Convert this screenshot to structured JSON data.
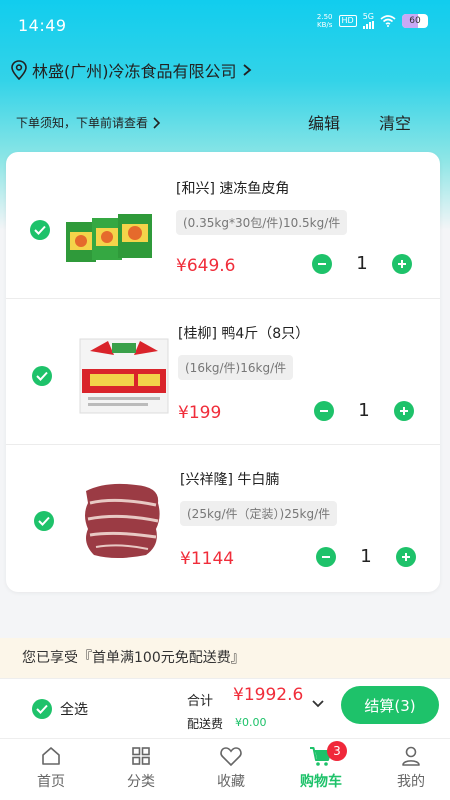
{
  "status_bar": {
    "time": "14:49",
    "net_speed_value": "2.50",
    "net_speed_unit": "KB/s",
    "hd": "HD",
    "network": "5G",
    "battery": "60"
  },
  "header": {
    "company": "林盛(广州)冷冻食品有限公司",
    "notice": "下单须知，下单前请查看",
    "edit_label": "编辑",
    "clear_label": "清空"
  },
  "cart": {
    "items": [
      {
        "name": "[和兴] 速冻鱼皮角",
        "spec": "(0.35kg*30包/件)10.5kg/件",
        "price": "¥649.6",
        "quantity": "1",
        "checked": true
      },
      {
        "name": "[桂柳] 鸭4斤（8只）",
        "spec": "(16kg/件)16kg/件",
        "price": "¥199",
        "quantity": "1",
        "checked": true
      },
      {
        "name": "[兴祥隆] 牛白腩",
        "spec": "(25kg/件（定装）)25kg/件",
        "price": "¥1144",
        "quantity": "1",
        "checked": true
      }
    ]
  },
  "promo": "您已享受『首单满100元免配送费』",
  "checkout": {
    "select_all_label": "全选",
    "total_label": "合计",
    "total_value": "¥1992.6",
    "fee_label": "配送费",
    "fee_value": "¥0.00",
    "button_label": "结算(3)"
  },
  "tabbar": {
    "tabs": [
      {
        "label": "首页",
        "icon": "home-icon"
      },
      {
        "label": "分类",
        "icon": "category-icon"
      },
      {
        "label": "收藏",
        "icon": "heart-icon"
      },
      {
        "label": "购物车",
        "icon": "cart-icon",
        "active": true,
        "badge": "3"
      },
      {
        "label": "我的",
        "icon": "user-icon"
      }
    ]
  },
  "colors": {
    "accent": "#1ec26a",
    "price": "#f02d3a",
    "header_gradient_top": "#11cdee",
    "badge": "#f0283a"
  }
}
